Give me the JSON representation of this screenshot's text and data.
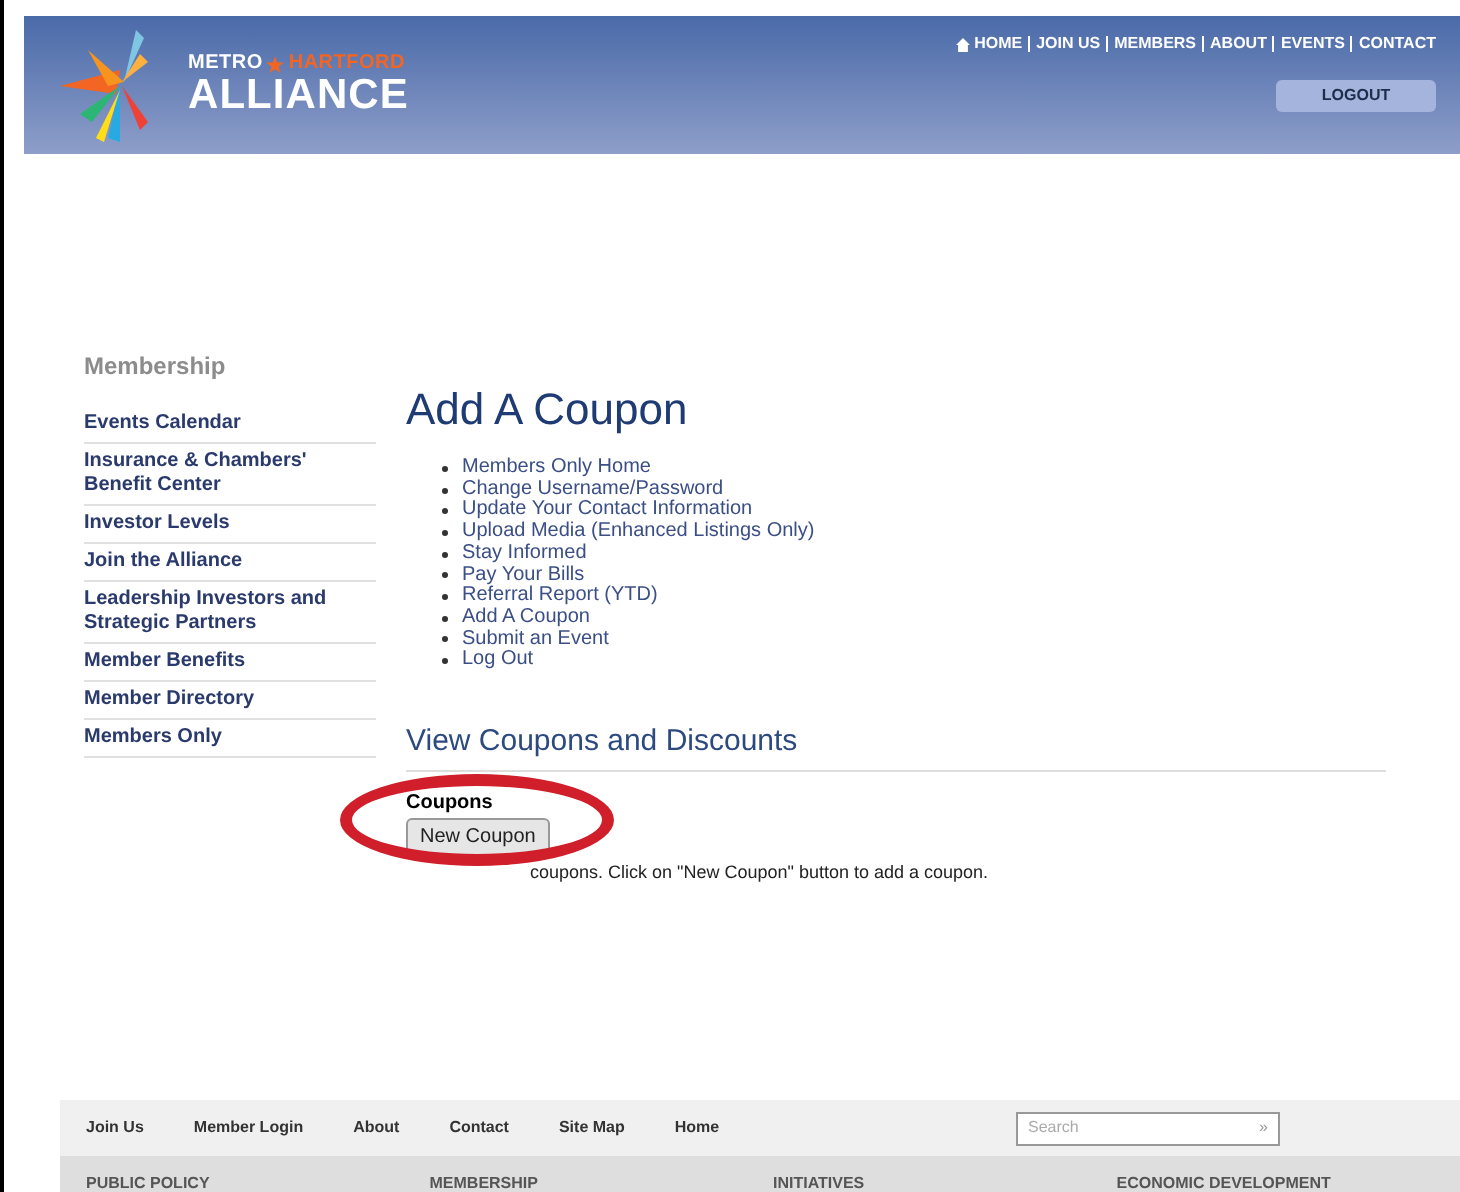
{
  "header": {
    "logo": {
      "top_left": "METRO",
      "top_right": "HARTFORD",
      "main": "ALLIANCE"
    },
    "top_nav": [
      {
        "label": "HOME"
      },
      {
        "label": "JOIN US"
      },
      {
        "label": "MEMBERS"
      },
      {
        "label": "ABOUT"
      },
      {
        "label": "EVENTS"
      },
      {
        "label": "CONTACT"
      }
    ],
    "logout_button": "LOGOUT"
  },
  "sidebar": {
    "title": "Membership",
    "items": [
      "Events Calendar",
      "Insurance & Chambers' Benefit Center",
      "Investor Levels",
      "Join the Alliance",
      "Leadership Investors and Strategic Partners",
      "Member Benefits",
      "Member Directory",
      "Members Only"
    ]
  },
  "main": {
    "title": "Add A Coupon",
    "links": [
      "Members Only Home",
      "Change Username/Password",
      "Update Your Contact Information",
      "Upload Media (Enhanced Listings Only)",
      "Stay Informed",
      "Pay Your Bills",
      "Referral Report (YTD)",
      "Add A Coupon",
      "Submit an Event",
      "Log Out"
    ],
    "section_title": "View Coupons and Discounts",
    "coupons_label": "Coupons",
    "new_coupon_button": "New Coupon",
    "message": "coupons. Click on \"New Coupon\" button to add a coupon."
  },
  "footer": {
    "links": [
      "Join Us",
      "Member Login",
      "About",
      "Contact",
      "Site Map",
      "Home"
    ],
    "search": {
      "placeholder": "Search",
      "submit": "»"
    },
    "columns": [
      "PUBLIC POLICY",
      "MEMBERSHIP",
      "INITIATIVES",
      "ECONOMIC DEVELOPMENT"
    ]
  }
}
